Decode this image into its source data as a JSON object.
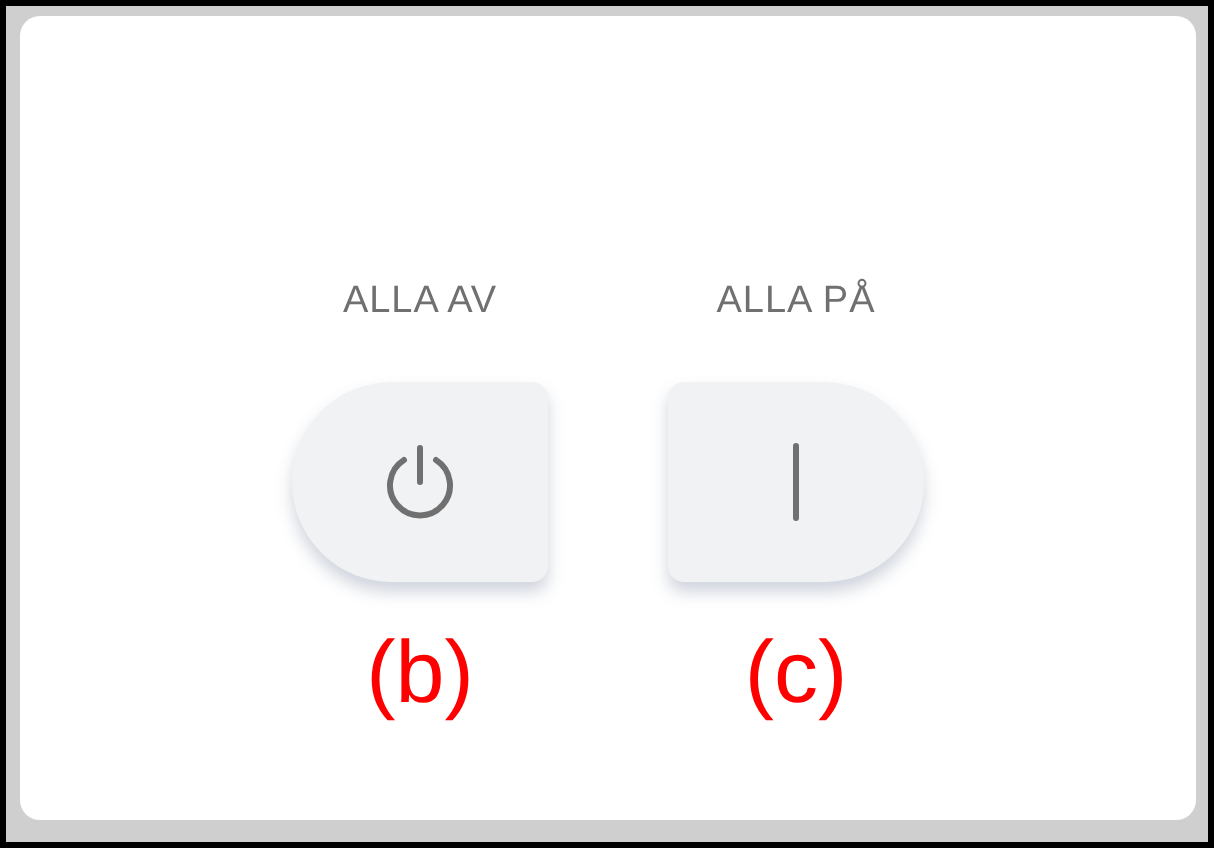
{
  "controls": [
    {
      "label": "ALLA AV",
      "kind": "power",
      "caption": "(b)"
    },
    {
      "label": "ALLA PÅ",
      "kind": "on",
      "caption": "(c)"
    }
  ]
}
